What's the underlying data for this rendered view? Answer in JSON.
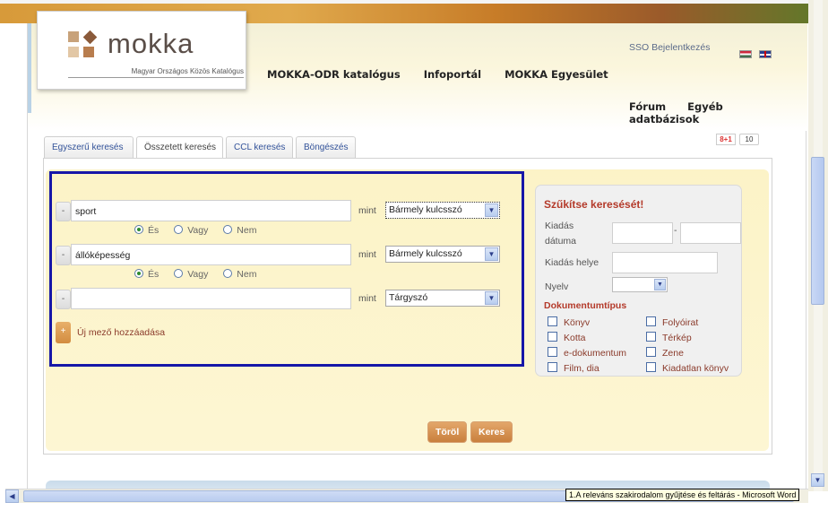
{
  "brand": {
    "logo_text": "mokka",
    "logo_subtitle": "Magyar Országos Közös Katalógus"
  },
  "nav_top": [
    "MOKKA-ODR katalógus",
    "Infoportál",
    "MOKKA Egyesület"
  ],
  "sso_label": "SSO Bejelentkezés",
  "nav_right": [
    "Fórum",
    "Egyéb adatbázisok"
  ],
  "tabs": [
    "Egyszerű keresés",
    "Összetett keresés",
    "CCL keresés",
    "Böngészés"
  ],
  "active_tab": "Összetett keresés",
  "social": {
    "gplus_label": "8+1",
    "count": "10"
  },
  "query": {
    "mint_label": "mint",
    "minus_label": "-",
    "rows": [
      {
        "value": "sport",
        "field": "Bármely kulcsszó"
      },
      {
        "value": "állóképesség",
        "field": "Bármely kulcsszó"
      },
      {
        "value": "",
        "field": "Tárgyszó"
      }
    ],
    "operators": [
      "És",
      "Vagy",
      "Nem"
    ],
    "selected_operator": "És",
    "add_field_label": "Új mező hozzáadása",
    "add_field_symbol": "+"
  },
  "narrow": {
    "title": "Szűkítse keresését!",
    "date_label_1": "Kiadás",
    "date_label_2": "dátuma",
    "date_sep": "-",
    "place_label": "Kiadás helye",
    "lang_label": "Nyelv",
    "doc_type_title": "Dokumentumtípus",
    "doc_types": [
      "Könyv",
      "Folyóirat",
      "Kotta",
      "Térkép",
      "e-dokumentum",
      "Zene",
      "Film, dia",
      "Kiadatlan könyv"
    ]
  },
  "buttons": {
    "clear": "Töröl",
    "search": "Keres"
  },
  "tooltip": "1.A releváns szakirodalom gyűjtése és feltárás - Microsoft Word",
  "colors": {
    "accent": "#b43a2a",
    "button": "#d28c40",
    "highlight_border": "#1616a8"
  }
}
